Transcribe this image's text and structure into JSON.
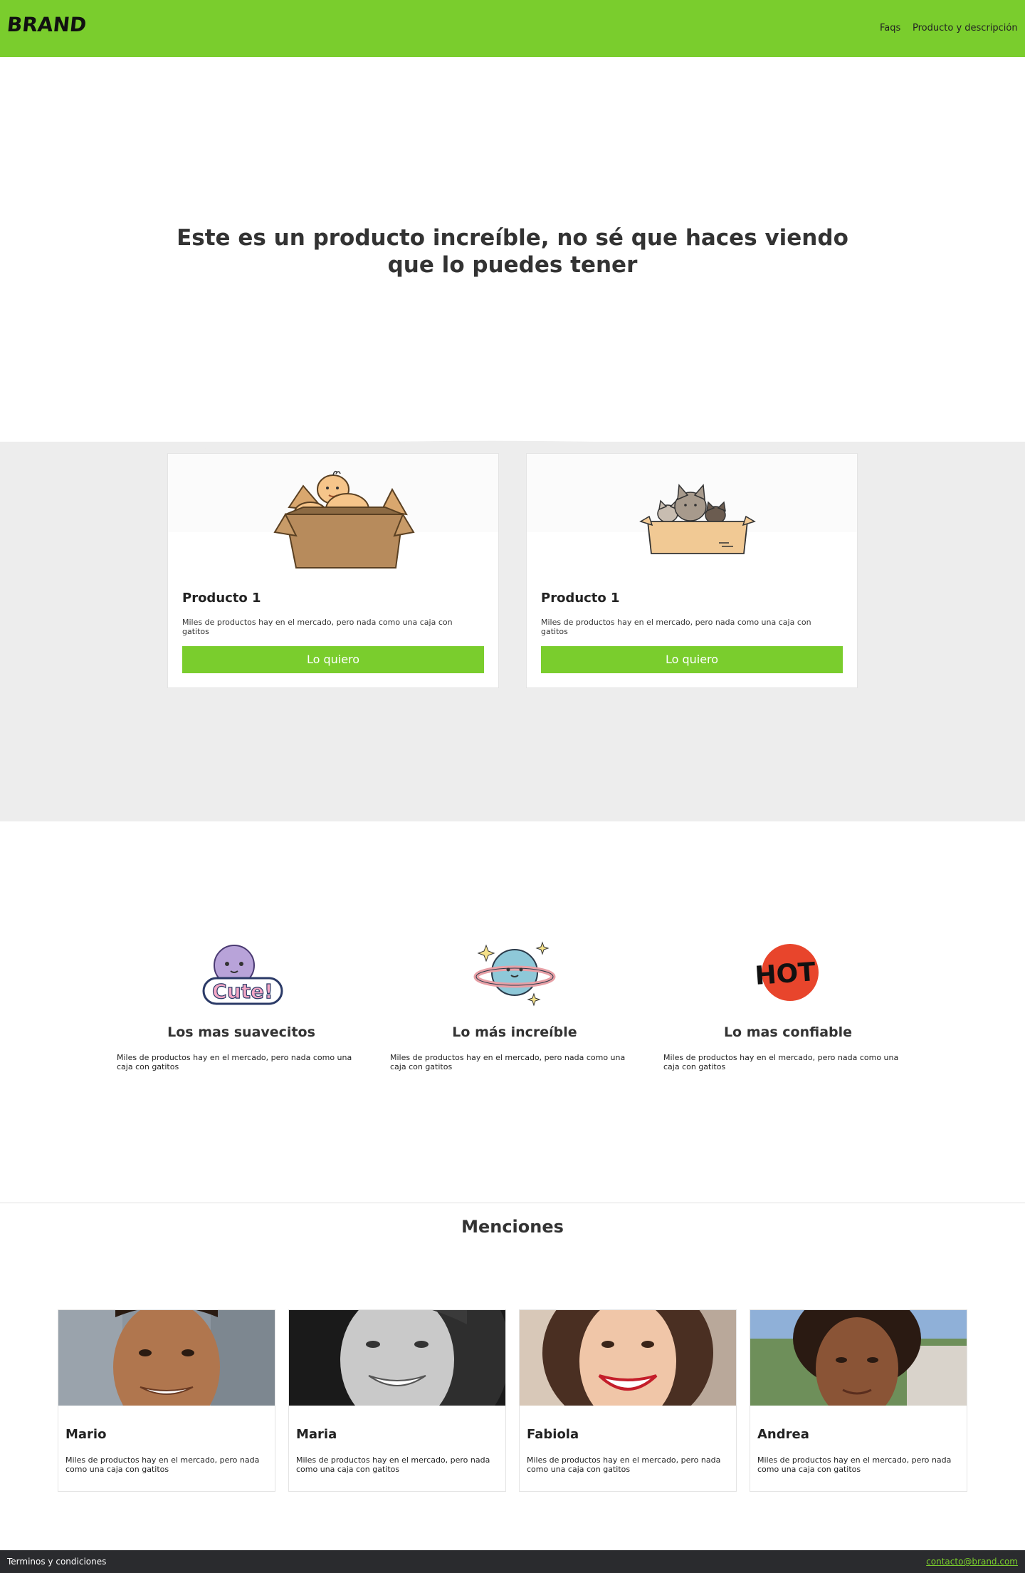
{
  "header": {
    "brand": "BRAND",
    "nav": [
      "Faqs",
      "Producto y descripción"
    ],
    "bg_color": "#7ACD2D"
  },
  "hero": {
    "title": "Este es un producto increíble, no sé que haces viendo que lo puedes tener"
  },
  "products": [
    {
      "image_icon": "baby-in-box-illustration",
      "title": "Producto 1",
      "description": "Miles de productos hay en el mercado, pero nada como una caja con gatitos",
      "button": "Lo quiero"
    },
    {
      "image_icon": "cats-in-box-illustration",
      "title": "Producto 1",
      "description": "Miles de productos hay en el mercado, pero nada como una caja con gatitos",
      "button": "Lo quiero"
    }
  ],
  "features": [
    {
      "icon": "cute-sticker-icon",
      "icon_text": "Cute!",
      "title": "Los mas suavecitos",
      "description": "Miles de productos hay en el mercado, pero nada como una caja con gatitos"
    },
    {
      "icon": "planet-icon",
      "title": "Lo más increíble",
      "description": "Miles de productos hay en el mercado, pero nada como una caja con gatitos"
    },
    {
      "icon": "hot-sticker-icon",
      "icon_text": "HOT",
      "title": "Lo mas confiable",
      "description": "Miles de productos hay en el mercado, pero nada como una caja con gatitos"
    }
  ],
  "mentions": {
    "title": "Menciones",
    "people": [
      {
        "name": "Mario",
        "description": "Miles de productos hay en el mercado, pero nada como una caja con gatitos"
      },
      {
        "name": "Maria",
        "description": "Miles de productos hay en el mercado, pero nada como una caja con gatitos"
      },
      {
        "name": "Fabiola",
        "description": "Miles de productos hay en el mercado, pero nada como una caja con gatitos"
      },
      {
        "name": "Andrea",
        "description": "Miles de productos hay en el mercado, pero nada como una caja con gatitos"
      }
    ]
  },
  "footer": {
    "terms": "Terminos y condiciones",
    "email": "contacto@brand.com"
  },
  "colors": {
    "accent": "#7ACD2D",
    "section_bg": "#EDEDED",
    "footer_bg": "#2A2B2E"
  }
}
